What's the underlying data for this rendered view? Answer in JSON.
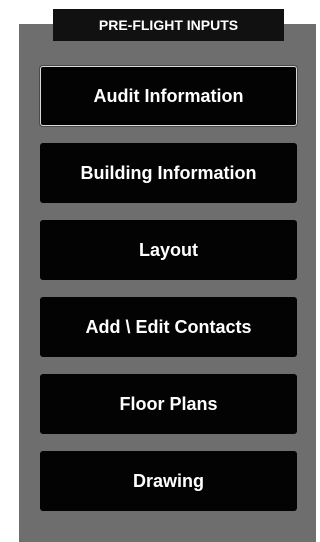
{
  "panel": {
    "title": "PRE-FLIGHT INPUTS",
    "buttons": [
      {
        "label": "Audit Information",
        "selected": true
      },
      {
        "label": "Building Information",
        "selected": false
      },
      {
        "label": "Layout",
        "selected": false
      },
      {
        "label": "Add \\ Edit Contacts",
        "selected": false
      },
      {
        "label": "Floor Plans",
        "selected": false
      },
      {
        "label": "Drawing",
        "selected": false
      }
    ]
  },
  "colors": {
    "panel_background": "#6e6e6e",
    "button_background": "#030303",
    "button_text": "#ffffff",
    "header_background": "#111111"
  }
}
